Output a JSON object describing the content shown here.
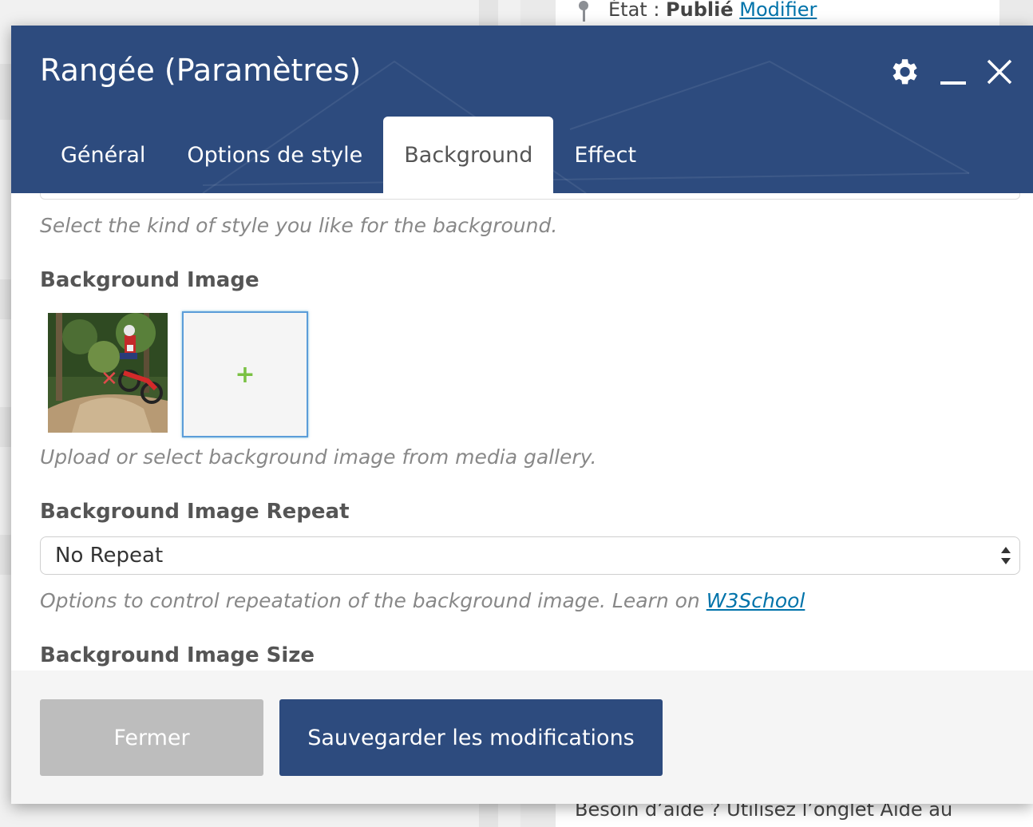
{
  "background_page": {
    "status_label": "État :",
    "status_value": "Publié",
    "status_link": "Modifier",
    "help_text": "Besoin d’aide ? Utilisez l’onglet Aide au"
  },
  "modal": {
    "title": "Rangée (Paramètres)",
    "settings_icon": "gear-icon",
    "minimize_icon": "minimize-icon",
    "close_icon": "close-icon",
    "tabs": [
      {
        "label": "Général",
        "active": false
      },
      {
        "label": "Options de style",
        "active": false
      },
      {
        "label": "Background",
        "active": true
      },
      {
        "label": "Effect",
        "active": false
      }
    ],
    "background_style_desc": "Select the kind of style you like for the background.",
    "background_image": {
      "label": "Background Image",
      "add_symbol": "+",
      "remove_symbol": "✕",
      "desc": "Upload or select background image from media gallery."
    },
    "background_repeat": {
      "label": "Background Image Repeat",
      "value": "No Repeat",
      "desc": "Options to control repeatation of the background image. Learn on",
      "link": "W3School"
    },
    "background_size": {
      "label": "Background Image Size"
    },
    "footer": {
      "close_label": "Fermer",
      "save_label": "Sauvegarder les modifications"
    },
    "colors": {
      "header": "#2d4b7e",
      "save_button": "#2d4b7e",
      "close_button": "#bdbdbd",
      "link": "#0073aa"
    }
  }
}
